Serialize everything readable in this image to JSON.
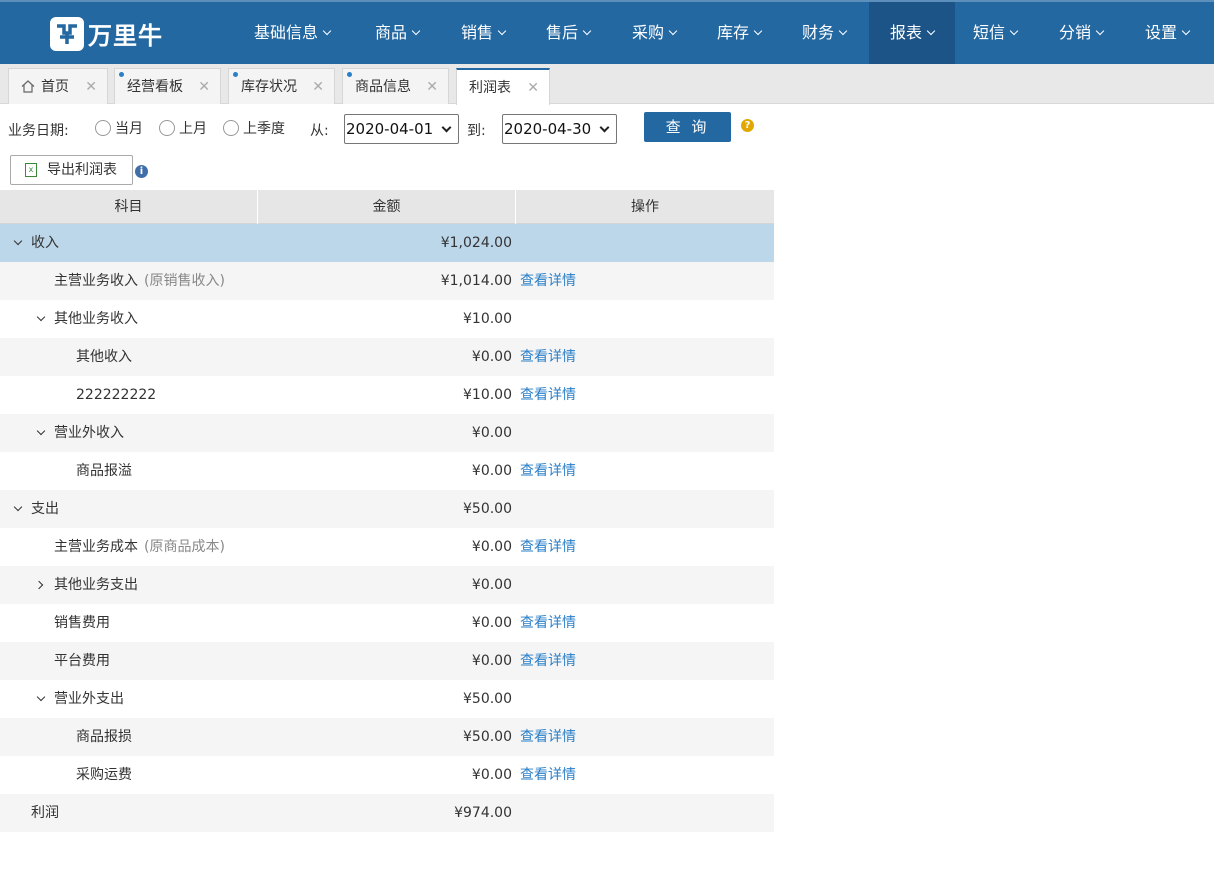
{
  "brand": {
    "name": "万里牛"
  },
  "nav": [
    {
      "label": "基础信息"
    },
    {
      "label": "商品"
    },
    {
      "label": "销售"
    },
    {
      "label": "售后"
    },
    {
      "label": "采购"
    },
    {
      "label": "库存"
    },
    {
      "label": "财务"
    },
    {
      "label": "报表"
    },
    {
      "label": "短信"
    },
    {
      "label": "分销"
    },
    {
      "label": "设置"
    }
  ],
  "nav_active": "报表",
  "tabs": [
    {
      "label": "首页"
    },
    {
      "label": "经营看板"
    },
    {
      "label": "库存状况"
    },
    {
      "label": "商品信息"
    },
    {
      "label": "利润表"
    }
  ],
  "filter": {
    "date_label": "业务日期:",
    "radio_current_month": "当月",
    "radio_last_month": "上月",
    "radio_last_quarter": "上季度",
    "from_label": "从:",
    "from_value": "2020-04-01",
    "to_label": "到:",
    "to_value": "2020-04-30",
    "query_label": "查 询",
    "help_glyph": "?"
  },
  "export": {
    "label": "导出利润表",
    "info_glyph": "i"
  },
  "table": {
    "headers": [
      "科目",
      "金额",
      "操作"
    ],
    "link_label": "查看详情",
    "rows": [
      {
        "name": "收入",
        "note": "",
        "amount": "¥1,024.00",
        "link": ""
      },
      {
        "name": "主营业务收入",
        "note": "(原销售收入)",
        "amount": "¥1,014.00",
        "link": "查看详情"
      },
      {
        "name": "其他业务收入",
        "note": "",
        "amount": "¥10.00",
        "link": ""
      },
      {
        "name": "其他收入",
        "note": "",
        "amount": "¥0.00",
        "link": "查看详情"
      },
      {
        "name": "222222222",
        "note": "",
        "amount": "¥10.00",
        "link": "查看详情"
      },
      {
        "name": "营业外收入",
        "note": "",
        "amount": "¥0.00",
        "link": ""
      },
      {
        "name": "商品报溢",
        "note": "",
        "amount": "¥0.00",
        "link": "查看详情"
      },
      {
        "name": "支出",
        "note": "",
        "amount": "¥50.00",
        "link": ""
      },
      {
        "name": "主营业务成本",
        "note": "(原商品成本)",
        "amount": "¥0.00",
        "link": "查看详情"
      },
      {
        "name": "其他业务支出",
        "note": "",
        "amount": "¥0.00",
        "link": ""
      },
      {
        "name": "销售费用",
        "note": "",
        "amount": "¥0.00",
        "link": "查看详情"
      },
      {
        "name": "平台费用",
        "note": "",
        "amount": "¥0.00",
        "link": "查看详情"
      },
      {
        "name": "营业外支出",
        "note": "",
        "amount": "¥50.00",
        "link": ""
      },
      {
        "name": "商品报损",
        "note": "",
        "amount": "¥50.00",
        "link": "查看详情"
      },
      {
        "name": "采购运费",
        "note": "",
        "amount": "¥0.00",
        "link": "查看详情"
      },
      {
        "name": "利润",
        "note": "",
        "amount": "¥974.00",
        "link": ""
      }
    ]
  },
  "colors": {
    "nav_bg": "#2468a2",
    "nav_active": "#1d5487",
    "link": "#2a7fc8",
    "selected_row": "#bcd6ea"
  }
}
